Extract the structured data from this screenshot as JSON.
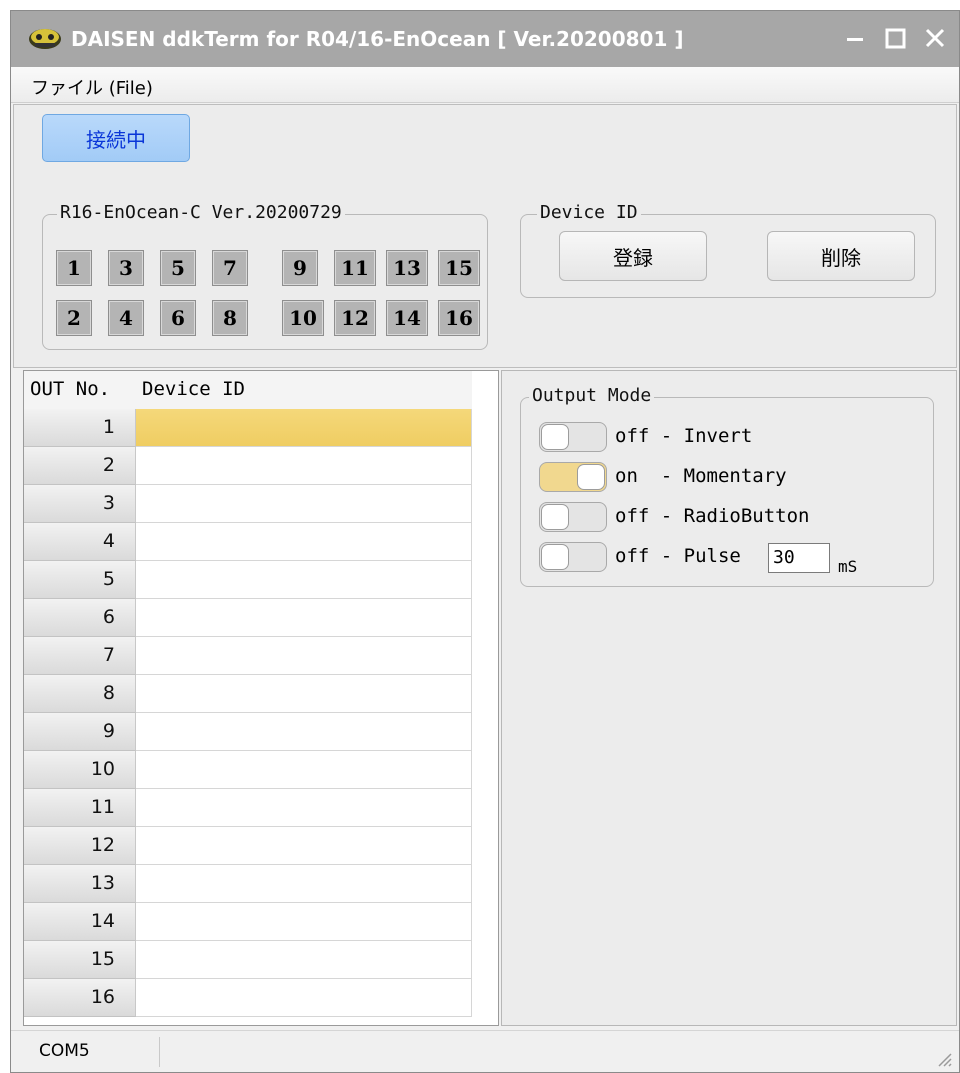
{
  "window": {
    "title": "DAISEN ddkTerm for R04/16-EnOcean [ Ver.20200801 ]"
  },
  "menu": {
    "file_label": "ファイル (File)"
  },
  "connection": {
    "status_label": "接続中"
  },
  "board": {
    "legend": "R16-EnOcean-C Ver.20200729",
    "outputs_row1": [
      "1",
      "3",
      "5",
      "7",
      "9",
      "11",
      "13",
      "15"
    ],
    "outputs_row2": [
      "2",
      "4",
      "6",
      "8",
      "10",
      "12",
      "14",
      "16"
    ]
  },
  "device_id": {
    "legend": "Device ID",
    "register_label": "登録",
    "delete_label": "削除"
  },
  "table": {
    "headers": [
      "OUT No.",
      "Device ID"
    ],
    "rows": [
      {
        "out": "1",
        "device_id": ""
      },
      {
        "out": "2",
        "device_id": ""
      },
      {
        "out": "3",
        "device_id": ""
      },
      {
        "out": "4",
        "device_id": ""
      },
      {
        "out": "5",
        "device_id": ""
      },
      {
        "out": "6",
        "device_id": ""
      },
      {
        "out": "7",
        "device_id": ""
      },
      {
        "out": "8",
        "device_id": ""
      },
      {
        "out": "9",
        "device_id": ""
      },
      {
        "out": "10",
        "device_id": ""
      },
      {
        "out": "11",
        "device_id": ""
      },
      {
        "out": "12",
        "device_id": ""
      },
      {
        "out": "13",
        "device_id": ""
      },
      {
        "out": "14",
        "device_id": ""
      },
      {
        "out": "15",
        "device_id": ""
      },
      {
        "out": "16",
        "device_id": ""
      }
    ],
    "selected_row": "1",
    "selected_color": "#f2d46f"
  },
  "output_mode": {
    "legend": "Output Mode",
    "modes": [
      {
        "state": "off",
        "label": "off - Invert"
      },
      {
        "state": "on",
        "label": "on  - Momentary"
      },
      {
        "state": "off",
        "label": "off - RadioButton"
      },
      {
        "state": "off",
        "label": "off - Pulse"
      }
    ],
    "pulse_value": "30",
    "pulse_unit": "mS"
  },
  "status": {
    "port": "COM5"
  },
  "colors": {
    "titlebar": "#a7a7a7",
    "connect_button": "#a9cff8",
    "connect_text": "#0a36d8",
    "toggle_on": "#f1d88f"
  }
}
